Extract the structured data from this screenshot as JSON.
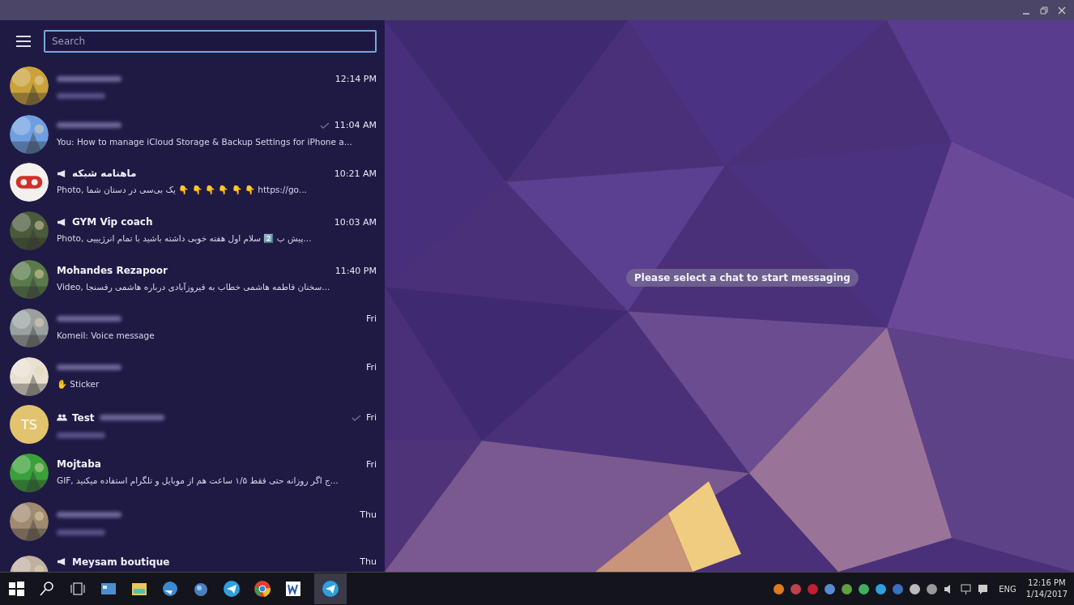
{
  "search": {
    "placeholder": "Search"
  },
  "chats": [
    {
      "blurred_name": true,
      "blurred_preview": true,
      "time": "12:14 PM",
      "read_check": false,
      "channel": false,
      "group": false
    },
    {
      "blurred_name": true,
      "preview": "You: How to manage iCloud Storage & Backup Settings for iPhone a...",
      "time": "11:04 AM",
      "read_check": true,
      "channel": false,
      "group": false
    },
    {
      "avatar": {
        "kind": "logo",
        "color": "#d0302a"
      },
      "name": "ماهنامه شبکه",
      "preview": "Photo, یک بی‌سی در دستان شما 👇 👇 👇 👇 👇 👇 https://go...",
      "time": "10:21 AM",
      "read_check": false,
      "channel": true,
      "group": false
    },
    {
      "name": "GYM Vip coach",
      "preview": "Photo, پیش ب 2️⃣ سلام اول هفته خوبی داشته باشید با تمام انرژیییی...",
      "time": "10:03 AM",
      "read_check": false,
      "channel": true,
      "group": false
    },
    {
      "name": "Mohandes Rezapoor",
      "preview": "Video, سخنان فاطمه هاشمی خطاب به فیروزآبادی درباره هاشمی رفسنجا...",
      "time": "11:40 PM",
      "read_check": false,
      "channel": false,
      "group": false
    },
    {
      "blurred_name": true,
      "preview": "Komeil: Voice message",
      "time": "Fri",
      "read_check": false,
      "channel": false,
      "group": false
    },
    {
      "blurred_name": true,
      "preview": "✋ Sticker",
      "time": "Fri",
      "read_check": false,
      "channel": false,
      "group": false
    },
    {
      "avatar": {
        "kind": "initials",
        "initials": "TS",
        "color": "#e3c46e"
      },
      "name": "Test",
      "blurred_name": true,
      "blurred_preview": true,
      "time": "Fri",
      "read_check": true,
      "channel": false,
      "group": true
    },
    {
      "name": "Mojtaba",
      "preview": "GIF, ج اگر روزانه حتی فقط ۱/۵ ساعت هم از موبایل و تلگرام استفاده میکنید...",
      "time": "Fri",
      "read_check": false,
      "channel": false,
      "group": false
    },
    {
      "blurred_name": true,
      "blurred_preview": true,
      "time": "Thu",
      "read_check": false,
      "channel": false,
      "group": false
    },
    {
      "name": "Meysam boutique",
      "time": "Thu",
      "read_check": false,
      "channel": true,
      "group": false
    }
  ],
  "empty_state": {
    "message": "Please select a chat to start messaging"
  },
  "taskbar": {
    "language": "ENG",
    "time": "12:16 PM",
    "date": "1/14/2017"
  }
}
